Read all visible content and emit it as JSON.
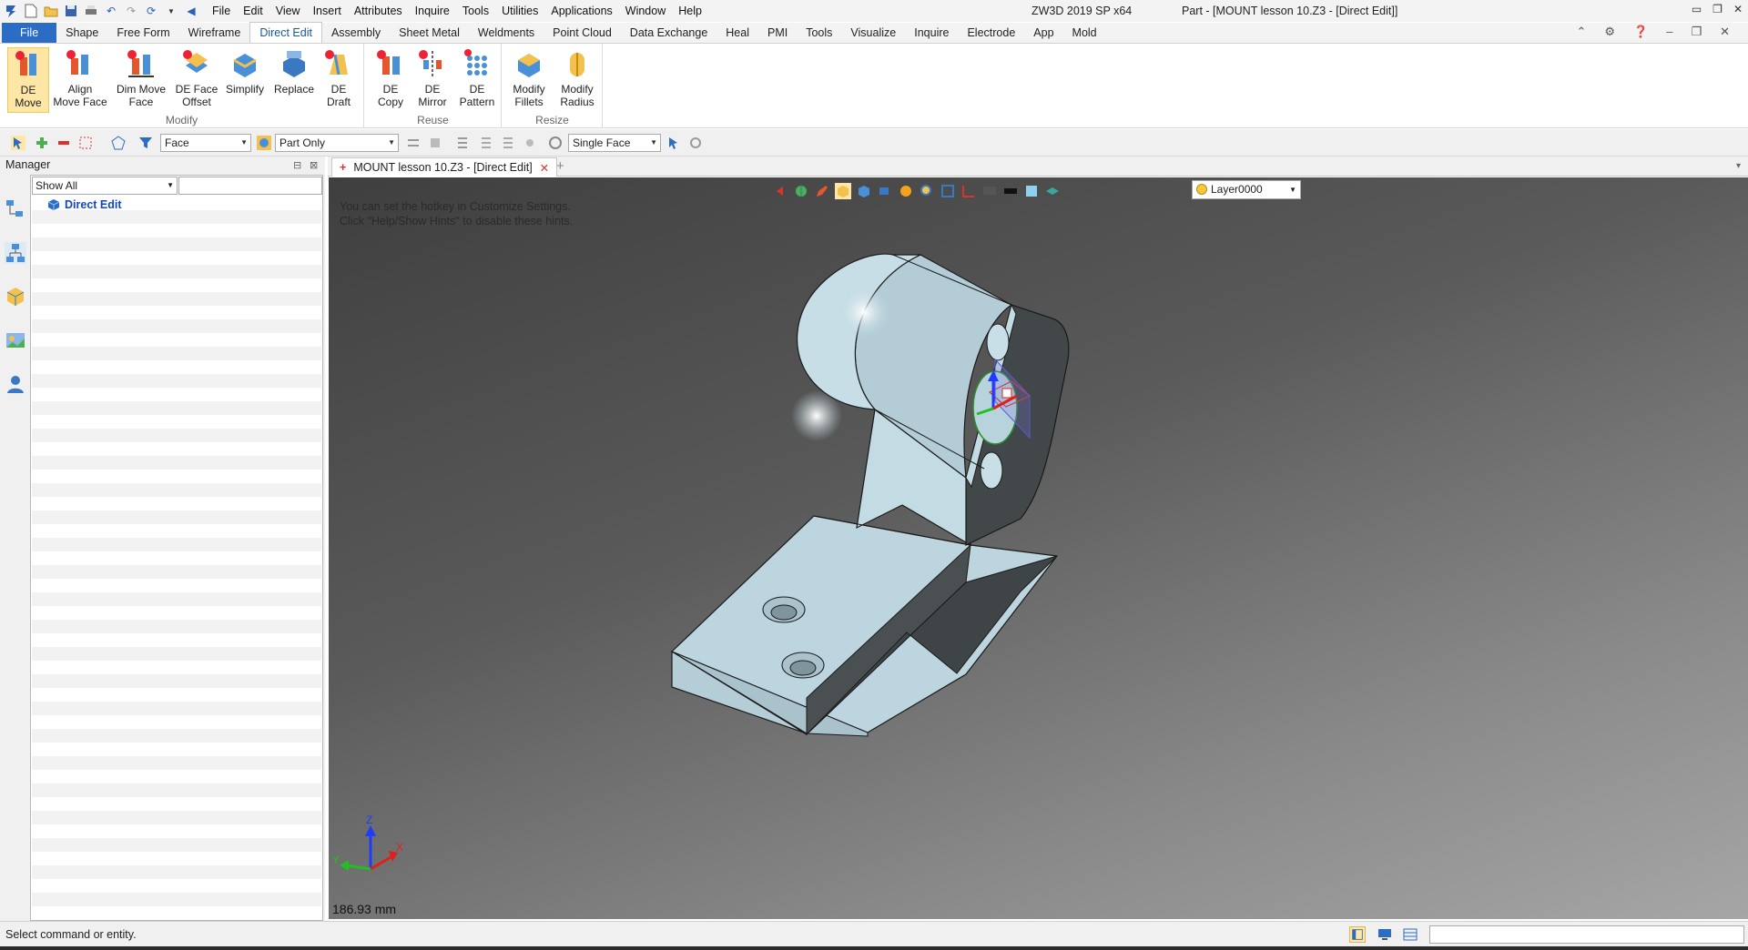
{
  "titlebar": {
    "app_title": "ZW3D 2019 SP x64",
    "doc_title": "Part - [MOUNT lesson 10.Z3 - [Direct Edit]]",
    "menu": [
      "File",
      "Edit",
      "View",
      "Insert",
      "Attributes",
      "Inquire",
      "Tools",
      "Utilities",
      "Applications",
      "Window",
      "Help"
    ]
  },
  "ribbon_tabs": [
    "File",
    "Shape",
    "Free Form",
    "Wireframe",
    "Direct Edit",
    "Assembly",
    "Sheet Metal",
    "Weldments",
    "Point Cloud",
    "Data Exchange",
    "Heal",
    "PMI",
    "Tools",
    "Visualize",
    "Inquire",
    "Electrode",
    "App",
    "Mold"
  ],
  "active_tab": "Direct Edit",
  "ribbon": {
    "groups": {
      "modify": "Modify",
      "reuse": "Reuse",
      "resize": "Resize"
    },
    "buttons": {
      "de_move": [
        "DE",
        "Move"
      ],
      "align_move_face": [
        "Align",
        "Move Face"
      ],
      "dim_move_face": [
        "Dim Move",
        "Face"
      ],
      "de_face_offset": [
        "DE Face",
        "Offset"
      ],
      "simplify": [
        "Simplify",
        ""
      ],
      "replace": [
        "Replace",
        ""
      ],
      "de_draft": [
        "DE",
        "Draft"
      ],
      "de_copy": [
        "DE",
        "Copy"
      ],
      "de_mirror": [
        "DE",
        "Mirror"
      ],
      "de_pattern": [
        "DE",
        "Pattern"
      ],
      "modify_fillets": [
        "Modify",
        "Fillets"
      ],
      "modify_radius": [
        "Modify",
        "Radius"
      ]
    }
  },
  "toolbar": {
    "filter": "Face",
    "scope": "Part Only",
    "pick_mode": "Single Face"
  },
  "manager": {
    "title": "Manager",
    "filter": "Show All",
    "tree_root": "Direct Edit"
  },
  "document_tab": "MOUNT lesson 10.Z3 - [Direct Edit]",
  "viewport": {
    "hint_line1": "You can set the hotkey in Customize Settings.",
    "hint_line2": "Click \"Help/Show Hints\" to disable these hints.",
    "layer": "Layer0000",
    "scale_text": "186.93 mm",
    "axis_labels": {
      "x": "X",
      "y": "Y",
      "z": "Z"
    }
  },
  "status": {
    "text": "Select command or entity."
  },
  "colors": {
    "accent": "#2b6cc4",
    "model_face": "#b9d3dc",
    "selection": "#fde6a6"
  }
}
